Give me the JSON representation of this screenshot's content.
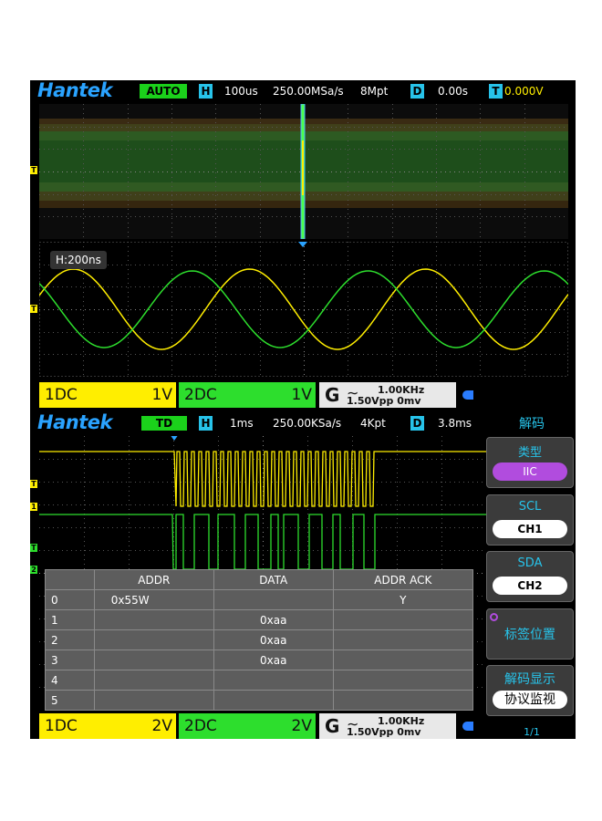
{
  "top": {
    "logo": "Hantek",
    "mode": "AUTO",
    "h_key": "H",
    "timebase": "100us",
    "sample_rate": "250.00MSa/s",
    "memory": "8Mpt",
    "d_key": "D",
    "delay": "0.00s",
    "t_key": "T",
    "trigger_level": "0.000V",
    "zoom_label": "H:200ns"
  },
  "top_channels": {
    "ch1_name": "1DC",
    "ch1_scale": "1V",
    "ch2_name": "2DC",
    "ch2_scale": "1V",
    "gen_key": "G",
    "gen_wave": "∼",
    "gen_freq": "1.00KHz",
    "gen_amp": "1.50Vpp",
    "gen_offset": "0mv"
  },
  "bottom": {
    "logo": "Hantek",
    "mode": "TD",
    "h_key": "H",
    "timebase": "1ms",
    "sample_rate": "250.00KSa/s",
    "memory": "4Kpt",
    "d_key": "D",
    "delay": "3.8ms"
  },
  "bottom_channels": {
    "ch1_name": "1DC",
    "ch1_scale": "2V",
    "ch2_name": "2DC",
    "ch2_scale": "2V",
    "gen_key": "G",
    "gen_wave": "∼",
    "gen_freq": "1.00KHz",
    "gen_amp": "1.50Vpp",
    "gen_offset": "0mv"
  },
  "menu": {
    "title": "解码",
    "type_label": "类型",
    "type_value": "IIC",
    "scl_label": "SCL",
    "scl_value": "CH1",
    "sda_label": "SDA",
    "sda_value": "CH2",
    "tag_label": "标签位置",
    "display_label": "解码显示",
    "display_value": "协议监视",
    "page": "1/1"
  },
  "decode_table": {
    "headers": [
      "",
      "ADDR",
      "DATA",
      "ADDR ACK"
    ],
    "rows": [
      [
        "0",
        "0x55W",
        "",
        "Y"
      ],
      [
        "1",
        "",
        "0xaa",
        ""
      ],
      [
        "2",
        "",
        "0xaa",
        ""
      ],
      [
        "3",
        "",
        "0xaa",
        ""
      ],
      [
        "4",
        "",
        "",
        ""
      ],
      [
        "5",
        "",
        "",
        ""
      ]
    ]
  },
  "markers": {
    "trigger": "T",
    "ch1": "1",
    "ch2": "2"
  },
  "colors": {
    "ch1": "#ffee00",
    "ch2": "#2dde2d",
    "accent": "#27c3ea",
    "logo": "#2aa3ff"
  }
}
